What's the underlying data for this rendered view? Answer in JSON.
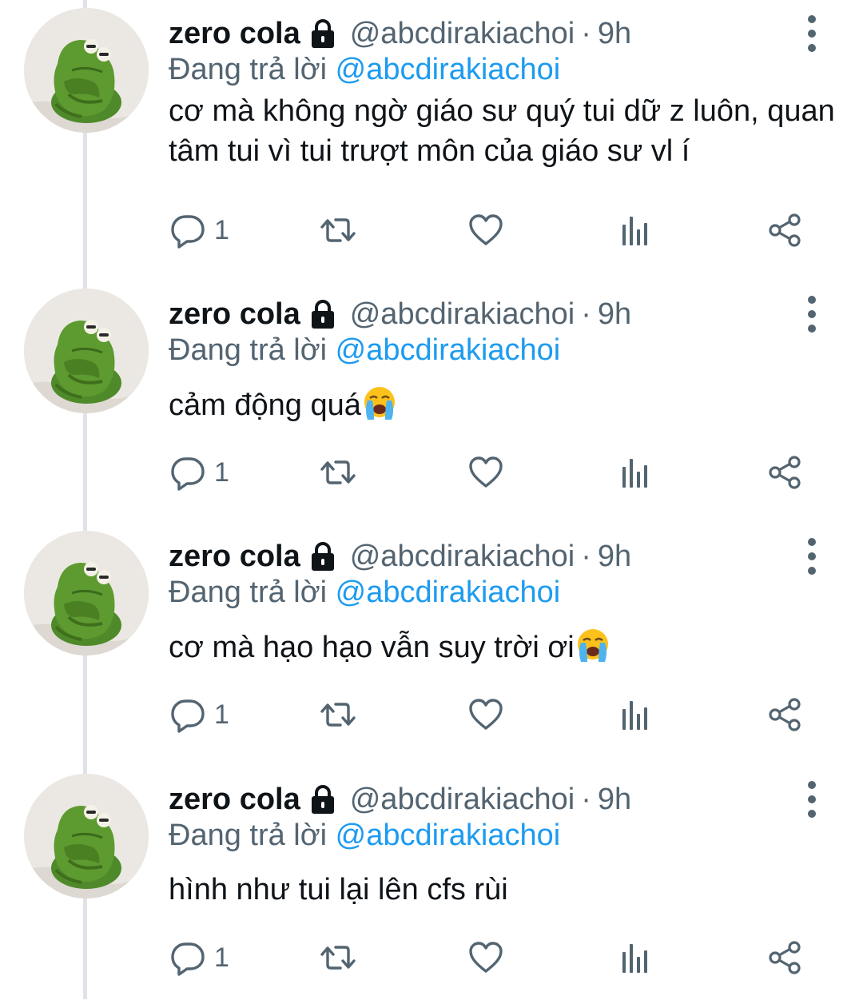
{
  "colors": {
    "text": "#0f1419",
    "secondary": "#536471",
    "accent": "#1d9bf0",
    "thread_line": "#dfe3e7"
  },
  "tweets": [
    {
      "name": "zero cola",
      "handle": "@abcdirakiachoi",
      "separator": "·",
      "time": "9h",
      "replying_prefix": "Đang trả lời",
      "replying_to": "@abcdirakiachoi",
      "text": "cơ mà không ngờ giáo sư quý tui dữ z luôn, quan tâm tui vì tui trượt môn của giáo sư vl í",
      "emoji": "",
      "reply_count": "1"
    },
    {
      "name": "zero cola",
      "handle": "@abcdirakiachoi",
      "separator": "·",
      "time": "9h",
      "replying_prefix": "Đang trả lời",
      "replying_to": "@abcdirakiachoi",
      "text": "cảm động quá",
      "emoji": "loudly-crying-face",
      "reply_count": "1"
    },
    {
      "name": "zero cola",
      "handle": "@abcdirakiachoi",
      "separator": "·",
      "time": "9h",
      "replying_prefix": "Đang trả lời",
      "replying_to": "@abcdirakiachoi",
      "text": "cơ mà hạo hạo vẫn suy trời ơi",
      "emoji": "loudly-crying-face",
      "reply_count": "1"
    },
    {
      "name": "zero cola",
      "handle": "@abcdirakiachoi",
      "separator": "·",
      "time": "9h",
      "replying_prefix": "Đang trả lời",
      "replying_to": "@abcdirakiachoi",
      "text": "hình như tui lại lên cfs rùi",
      "emoji": "",
      "reply_count": "1"
    }
  ],
  "icons": {
    "lock": "lock-icon",
    "more": "more-vertical-icon",
    "reply": "reply-icon",
    "retweet": "retweet-icon",
    "like": "heart-icon",
    "views": "views-chart-icon",
    "share": "share-icon"
  }
}
